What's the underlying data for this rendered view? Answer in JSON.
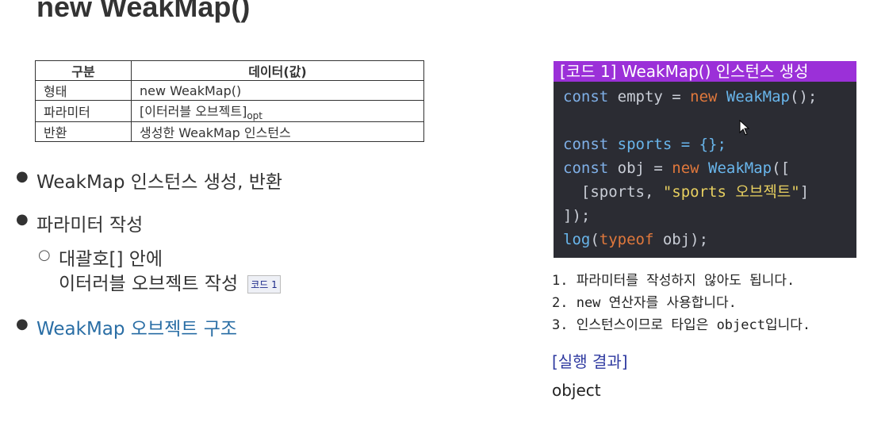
{
  "title": "new WeakMap()",
  "table": {
    "headers": [
      "구분",
      "데이터(값)"
    ],
    "rows": [
      {
        "label": "형태",
        "value": "new WeakMap()",
        "suffix": ""
      },
      {
        "label": "파라미터",
        "value": "[이터러블 오브젝트]",
        "suffix": "opt"
      },
      {
        "label": "반환",
        "value": "생성한 WeakMap 인스턴스",
        "suffix": ""
      }
    ]
  },
  "bullets": {
    "item1": "WeakMap 인스턴스 생성, 반환",
    "item2": "파라미터 작성",
    "sub_line1": "대괄호[] 안에",
    "sub_line2": "이터러블 오브젝트 작성",
    "sub_chip": "코드 1",
    "item3": "WeakMap 오브젝트 구조"
  },
  "code_panel": {
    "title": "[코드 1] WeakMap() 인스턴스 생성",
    "line1": {
      "k": "const",
      "v": " empty = ",
      "n": "new",
      "f": " WeakMap",
      "p": "();"
    },
    "line2": {
      "k": "const",
      "v": " sports = {};"
    },
    "line3": {
      "k": "const",
      "v": " obj = ",
      "n": "new",
      "f": " WeakMap",
      "p": "(["
    },
    "line4": {
      "a": "  [sports, ",
      "s": "\"sports 오브젝트\"",
      "b": "]"
    },
    "line5": "]);",
    "line6": {
      "f": "log",
      "p1": "(",
      "k": "typeof",
      "v": " obj);"
    }
  },
  "notes": [
    "1. 파라미터를 작성하지 않아도 됩니다.",
    "2. new 연산자를 사용합니다.",
    "3. 인스턴스이므로 타입은 object입니다."
  ],
  "result": {
    "heading": "[실행 결과]",
    "value": "object"
  },
  "colors": {
    "code_header": "#9b30d8",
    "code_background": "#2b2c33",
    "link": "#2a6ea5"
  }
}
